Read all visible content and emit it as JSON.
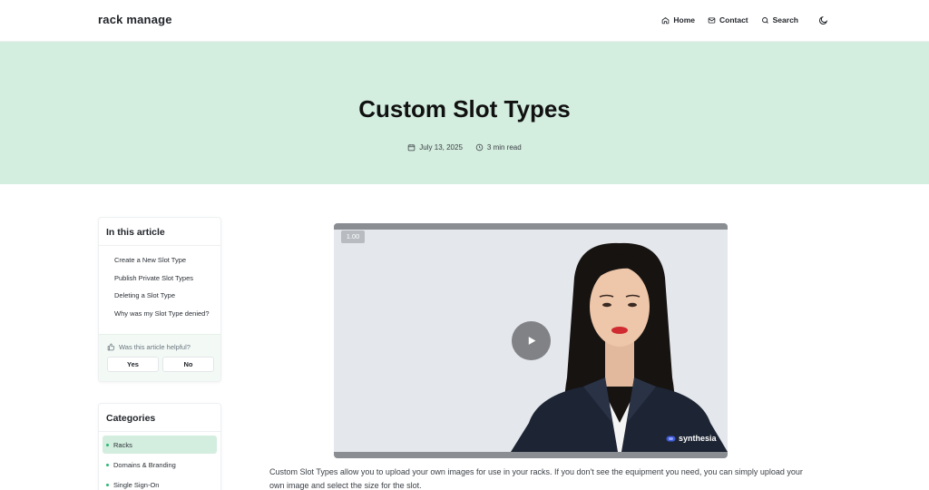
{
  "header": {
    "brand": "rack manage",
    "nav": [
      {
        "label": "Home",
        "icon": "home-icon"
      },
      {
        "label": "Contact",
        "icon": "mail-icon"
      },
      {
        "label": "Search",
        "icon": "search-icon"
      }
    ],
    "theme_icon": "moon-icon"
  },
  "hero": {
    "title": "Custom Slot Types",
    "date": "July 13, 2025",
    "read_time": "3 min read",
    "background": "#d3eddf"
  },
  "toc": {
    "title": "In this article",
    "items": [
      "Create a New Slot Type",
      "Publish Private Slot Types",
      "Deleting a Slot Type",
      "Why was my Slot Type denied?"
    ],
    "helpful_question": "Was this article helpful?",
    "yes_label": "Yes",
    "no_label": "No"
  },
  "categories": {
    "title": "Categories",
    "items": [
      "Racks",
      "Domains & Branding",
      "Single Sign-On"
    ],
    "active": "Racks",
    "accent": "#2bb673"
  },
  "video": {
    "speed": "1.00",
    "watermark": "synthesia"
  },
  "article": {
    "intro": "Custom Slot Types allow you to upload your own images for use in your racks. If you don't see the equipment you need, you can simply upload your own image and select the size for the slot."
  }
}
